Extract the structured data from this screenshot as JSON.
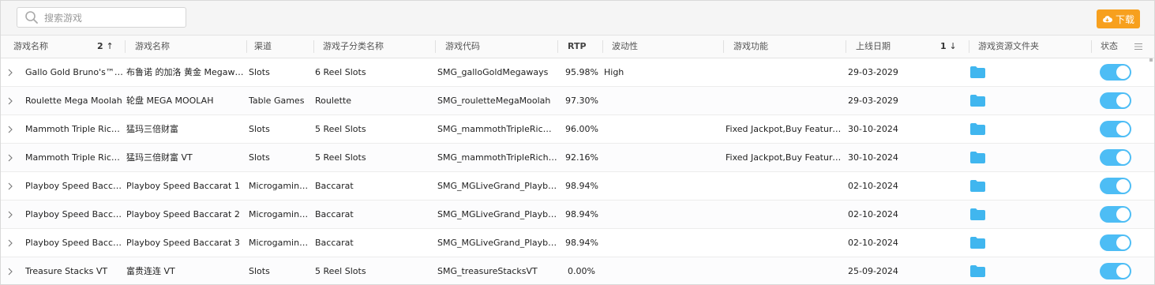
{
  "search": {
    "placeholder": "搜索游戏"
  },
  "toolbar": {
    "download_label": "下载",
    "accent": "#f7a01e"
  },
  "header": {
    "columns": [
      "游戏名称",
      "游戏名称",
      "渠道",
      "游戏子分类名称",
      "游戏代码",
      "RTP",
      "波动性",
      "游戏功能",
      "上线日期",
      "游戏资源文件夹",
      "状态"
    ],
    "sort_name": {
      "order": "2",
      "arrow": "↑"
    },
    "sort_date": {
      "order": "1",
      "arrow": "↓"
    }
  },
  "toggle_color": "#4dbdf5",
  "rows": [
    {
      "name_en": "Gallo Gold Bruno's™ ...",
      "name_cn": "布鲁诺 的加洛 黄金 Megaways",
      "channel": "Slots",
      "subcat": "6 Reel Slots",
      "code": "SMG_galloGoldMegaways",
      "rtp": "95.98%",
      "volatility": "High",
      "features": "",
      "date": "29-03-2029",
      "enabled": true
    },
    {
      "name_en": "Roulette Mega Moolah",
      "name_cn": "轮盘 MEGA MOOLAH",
      "channel": "Table Games",
      "subcat": "Roulette",
      "code": "SMG_rouletteMegaMoolah",
      "rtp": "97.30%",
      "volatility": "",
      "features": "",
      "date": "29-03-2029",
      "enabled": true
    },
    {
      "name_en": "Mammoth Triple Riches",
      "name_cn": "猛玛三倍财富",
      "channel": "Slots",
      "subcat": "5 Reel Slots",
      "code": "SMG_mammothTripleRiches",
      "rtp": "96.00%",
      "volatility": "",
      "features": "Fixed Jackpot,Buy Feature,F...",
      "date": "30-10-2024",
      "enabled": true
    },
    {
      "name_en": "Mammoth Triple Riche...",
      "name_cn": "猛玛三倍财富 VT",
      "channel": "Slots",
      "subcat": "5 Reel Slots",
      "code": "SMG_mammothTripleRiches...",
      "rtp": "92.16%",
      "volatility": "",
      "features": "Fixed Jackpot,Buy Feature,F...",
      "date": "30-10-2024",
      "enabled": true
    },
    {
      "name_en": "Playboy Speed Baccar...",
      "name_cn": "Playboy Speed Baccarat 1",
      "channel": "Microgaming ...",
      "subcat": "Baccarat",
      "code": "SMG_MGLiveGrand_Playbo...",
      "rtp": "98.94%",
      "volatility": "",
      "features": "",
      "date": "02-10-2024",
      "enabled": true
    },
    {
      "name_en": "Playboy Speed Baccar...",
      "name_cn": "Playboy Speed Baccarat 2",
      "channel": "Microgaming ...",
      "subcat": "Baccarat",
      "code": "SMG_MGLiveGrand_Playbo...",
      "rtp": "98.94%",
      "volatility": "",
      "features": "",
      "date": "02-10-2024",
      "enabled": true
    },
    {
      "name_en": "Playboy Speed Baccar...",
      "name_cn": "Playboy Speed Baccarat 3",
      "channel": "Microgaming ...",
      "subcat": "Baccarat",
      "code": "SMG_MGLiveGrand_Playbo...",
      "rtp": "98.94%",
      "volatility": "",
      "features": "",
      "date": "02-10-2024",
      "enabled": true
    },
    {
      "name_en": "Treasure Stacks VT",
      "name_cn": "富贵连连 VT",
      "channel": "Slots",
      "subcat": "5 Reel Slots",
      "code": "SMG_treasureStacksVT",
      "rtp": "0.00%",
      "volatility": "",
      "features": "",
      "date": "25-09-2024",
      "enabled": true
    }
  ]
}
